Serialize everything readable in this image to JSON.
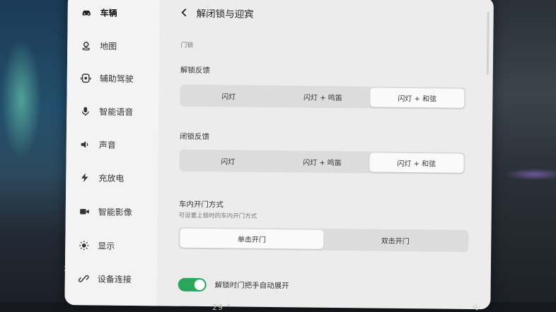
{
  "sidebar": {
    "items": [
      {
        "label": "车辆",
        "icon": "car-icon",
        "active": true
      },
      {
        "label": "地图",
        "icon": "map-pin-icon",
        "active": false
      },
      {
        "label": "辅助驾驶",
        "icon": "assisted-driving-icon",
        "active": false
      },
      {
        "label": "智能语音",
        "icon": "microphone-icon",
        "active": false
      },
      {
        "label": "声音",
        "icon": "speaker-icon",
        "active": false
      },
      {
        "label": "充放电",
        "icon": "lightning-icon",
        "active": false
      },
      {
        "label": "智能影像",
        "icon": "camera-icon",
        "active": false
      },
      {
        "label": "显示",
        "icon": "brightness-icon",
        "active": false
      },
      {
        "label": "设备连接",
        "icon": "link-icon",
        "active": false
      }
    ]
  },
  "header": {
    "back_icon": "chevron-left-icon",
    "title": "解闭锁与迎宾"
  },
  "main": {
    "section_label": "门锁",
    "unlock_feedback": {
      "title": "解锁反馈",
      "options": [
        "闪灯",
        "闪灯 + 鸣笛",
        "闪灯 + 和弦"
      ],
      "selected": "闪灯 + 和弦"
    },
    "lock_feedback": {
      "title": "闭锁反馈",
      "options": [
        "闪灯",
        "闪灯 + 鸣笛",
        "闪灯 + 和弦"
      ],
      "selected": "闪灯 + 和弦"
    },
    "interior_door": {
      "title": "车内开门方式",
      "subtitle": "可设置上锁时的车内开门方式",
      "options": [
        "单击开门",
        "双击开门"
      ],
      "selected": "单击开门"
    },
    "auto_handle": {
      "label": "解锁时门把手自动展开",
      "enabled": true
    }
  },
  "colors": {
    "toggle_on": "#2aa65a",
    "panel_bg": "#ececec",
    "segment_bg": "#dcdcdc",
    "segment_selected": "#fafafa"
  },
  "status_bar": {
    "partial_text": "29 °",
    "stray_digit": "2"
  }
}
